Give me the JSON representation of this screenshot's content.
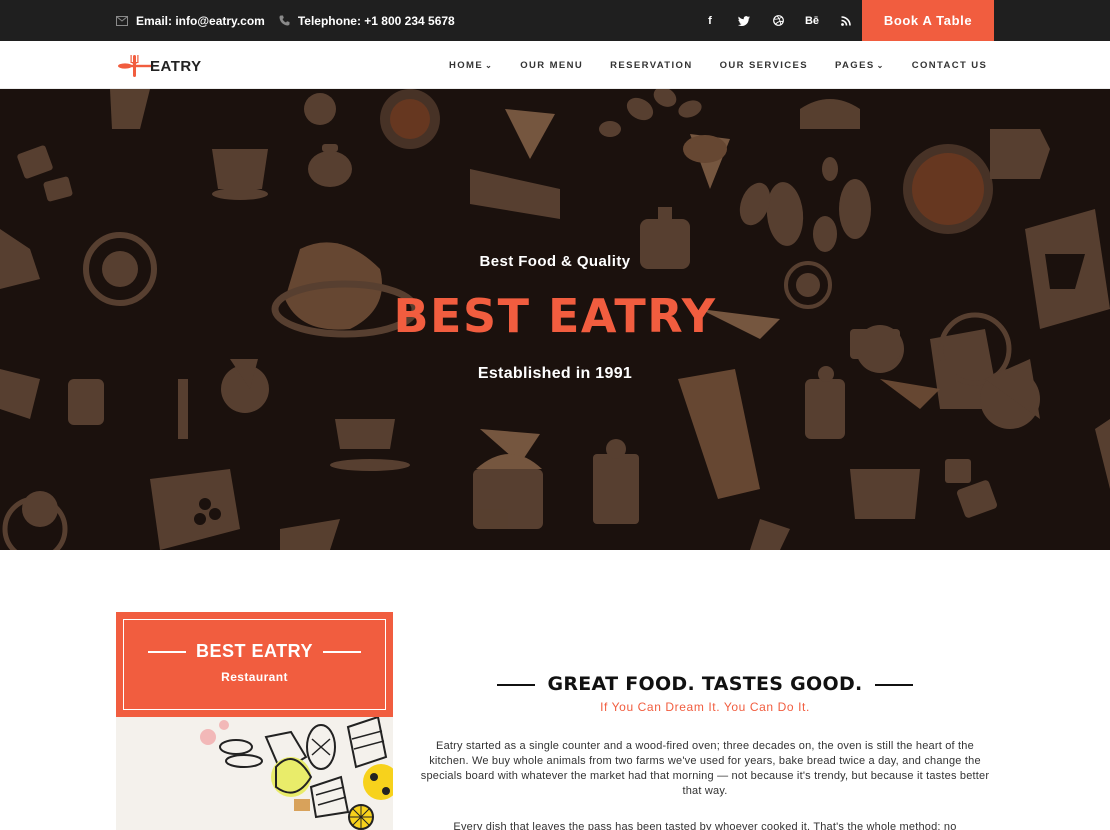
{
  "topbar": {
    "email": "Email: info@eatry.com",
    "phone": "Telephone: +1 800 234 5678",
    "social": [
      {
        "icon": "facebook-icon",
        "glyph": "f"
      },
      {
        "icon": "twitter-icon",
        "glyph": "🐦"
      },
      {
        "icon": "dribbble-icon",
        "glyph": "◎"
      },
      {
        "icon": "behance-icon",
        "glyph": "Bē"
      },
      {
        "icon": "rss-icon",
        "glyph": "◢"
      }
    ],
    "book_label": "Book A Table"
  },
  "brand": {
    "name": "EATRY",
    "accent": "#f15d3f"
  },
  "nav": [
    {
      "label": "HOME",
      "dropdown": true
    },
    {
      "label": "OUR MENU",
      "dropdown": false
    },
    {
      "label": "RESERVATION",
      "dropdown": false
    },
    {
      "label": "OUR SERVICES",
      "dropdown": false
    },
    {
      "label": "PAGES",
      "dropdown": true
    },
    {
      "label": "CONTACT US",
      "dropdown": false
    }
  ],
  "hero": {
    "subtitle": "Best Food & Quality",
    "title": "BEST EATRY",
    "established": "Established in 1991"
  },
  "card": {
    "title": "BEST EATRY",
    "kind": "Restaurant"
  },
  "about": {
    "heading": "GREAT FOOD. TASTES GOOD.",
    "tagline": "If You Can Dream It. You Can Do It.",
    "paragraph": "Eatry started as a single counter and a wood-fired oven; three decades on, the oven is still the heart of the kitchen. We buy whole animals from two farms we've used for years, bake bread twice a day, and change the specials board with whatever the market had that morning — not because it's trendy, but because it tastes better that way.",
    "paragraph2": "Every dish that leaves the pass has been tasted by whoever cooked it. That's the whole method; no"
  }
}
